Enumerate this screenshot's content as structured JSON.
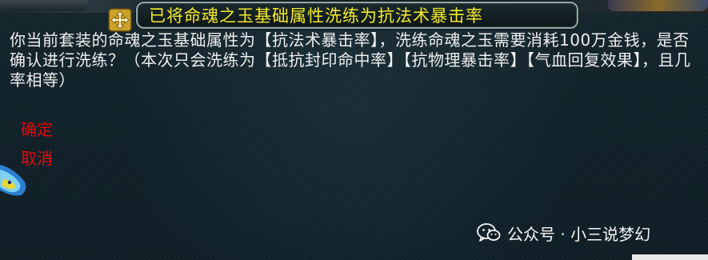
{
  "dialog": {
    "title": "已将命魂之玉基础属性洗练为抗法术暴击率",
    "message": "你当前套装的命魂之玉基础属性为【抗法术暴击率】，洗练命魂之玉需要消耗100万金钱，是否确认进行洗练？（本次只会洗练为【抵抗封印命中率】【抗物理暴击率】【气血回复效果】，且几率相等）",
    "options": [
      {
        "label": "确定"
      },
      {
        "label": "取消"
      }
    ]
  },
  "watermark": {
    "text": "公众号 · 小三说梦幻"
  },
  "colors": {
    "title": "#f4ea2a",
    "message": "#efefef",
    "option": "#e20b0b",
    "background": "#0f1d24"
  },
  "icons": {
    "move": "move-arrows-icon",
    "side": "pet-head-icon",
    "watermark": "wechat-icon"
  }
}
